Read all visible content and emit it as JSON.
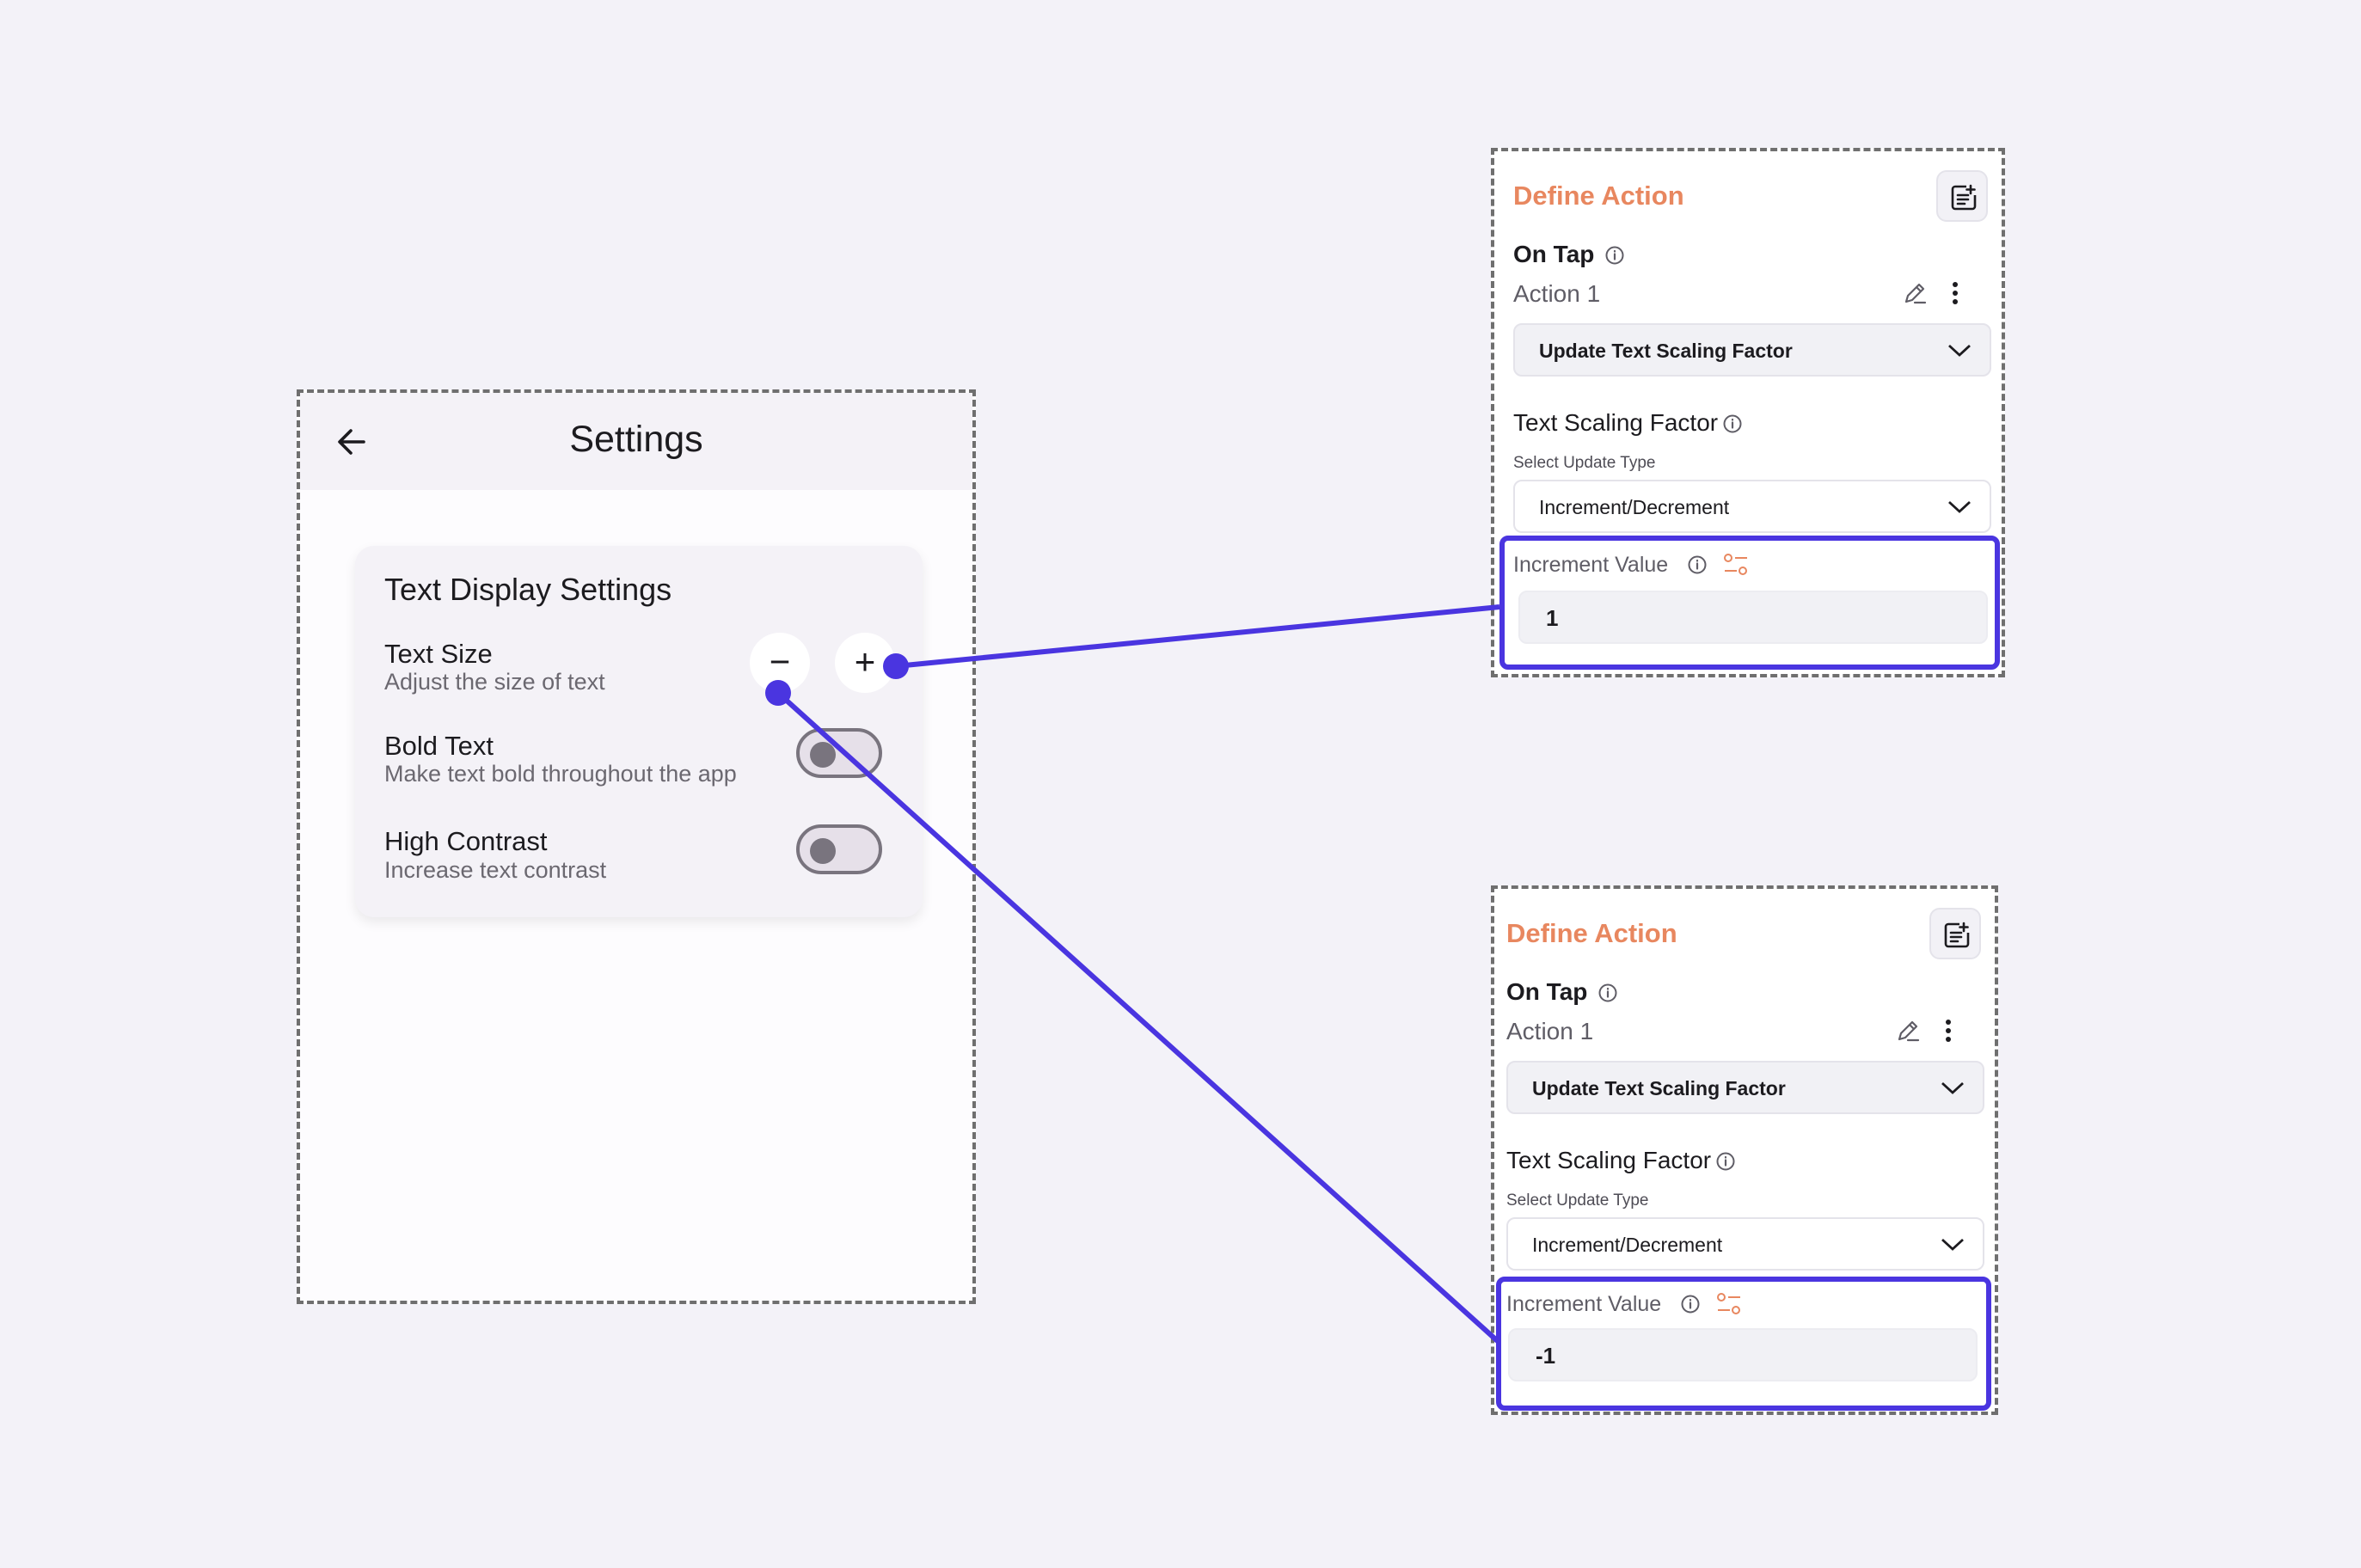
{
  "colors": {
    "accent": "#4a35e0",
    "panel_title": "#e8875f",
    "background": "#f3f2f8"
  },
  "settings_screen": {
    "back_icon": "arrow-left-icon",
    "title": "Settings",
    "card": {
      "title": "Text Display Settings",
      "text_size": {
        "title": "Text Size",
        "subtitle": "Adjust the size of text",
        "decrease_label": "−",
        "increase_label": "+"
      },
      "bold_text": {
        "title": "Bold Text",
        "subtitle": "Make text bold throughout the app",
        "enabled": false
      },
      "high_contrast": {
        "title": "High Contrast",
        "subtitle": "Increase text contrast",
        "enabled": false
      }
    }
  },
  "panels": [
    {
      "title": "Define Action",
      "trigger": "On Tap",
      "action_name": "Action 1",
      "action_type": "Update Text Scaling Factor",
      "section_title": "Text Scaling Factor",
      "update_type_label": "Select Update Type",
      "update_type": "Increment/Decrement",
      "increment_label": "Increment Value",
      "increment_value": "1"
    },
    {
      "title": "Define Action",
      "trigger": "On Tap",
      "action_name": "Action 1",
      "action_type": "Update Text Scaling Factor",
      "section_title": "Text Scaling Factor",
      "update_type_label": "Select Update Type",
      "update_type": "Increment/Decrement",
      "increment_label": "Increment Value",
      "increment_value": "-1"
    }
  ]
}
